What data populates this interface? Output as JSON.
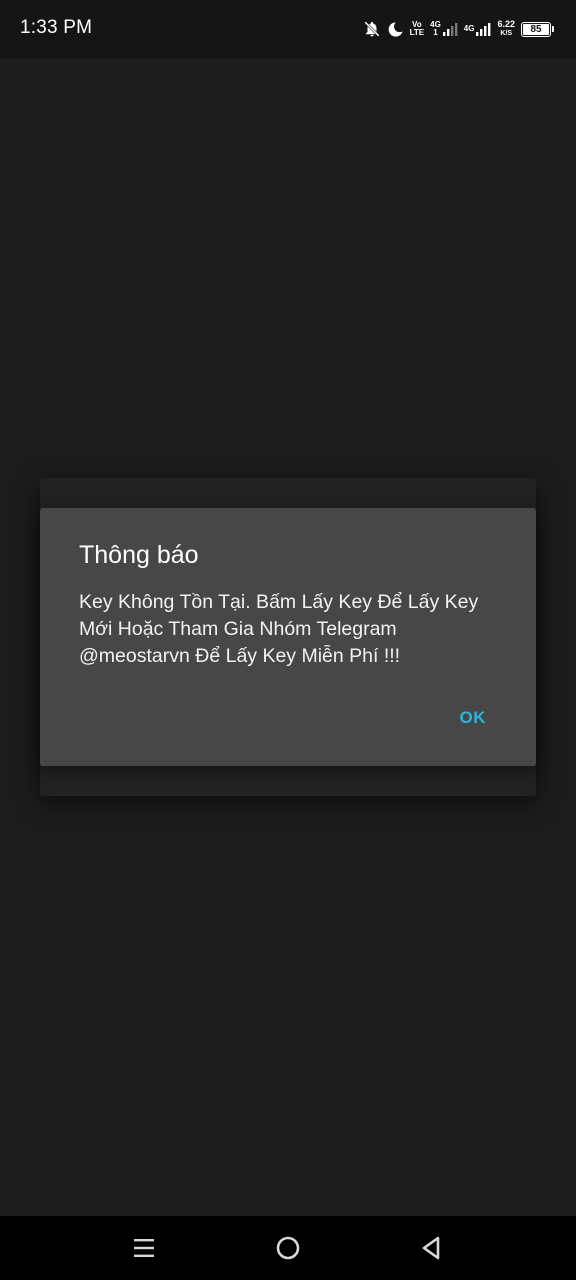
{
  "status_bar": {
    "time": "1:33 PM",
    "volte_top": "Vo",
    "volte_bottom": "LTE",
    "sim1_network": "4G",
    "sim1_sub": "1",
    "sim2_network": "4G",
    "speed_value": "6.22",
    "speed_unit": "K/S",
    "battery_level": "85",
    "icons": [
      "bell-off-icon",
      "moon-icon",
      "volte-icon",
      "signal-icon",
      "signal-icon",
      "battery-icon"
    ]
  },
  "dialog": {
    "title": "Thông báo",
    "message": "Key Không Tồn Tại. Bấm Lấy Key Để Lấy Key Mới Hoặc Tham Gia Nhóm Telegram @meostarvn Để Lấy Key Miễn Phí !!!",
    "ok_label": "OK",
    "accent_color": "#2fb4d8"
  },
  "nav_bar": {
    "icons": [
      "menu-icon",
      "home-icon",
      "back-icon"
    ]
  }
}
